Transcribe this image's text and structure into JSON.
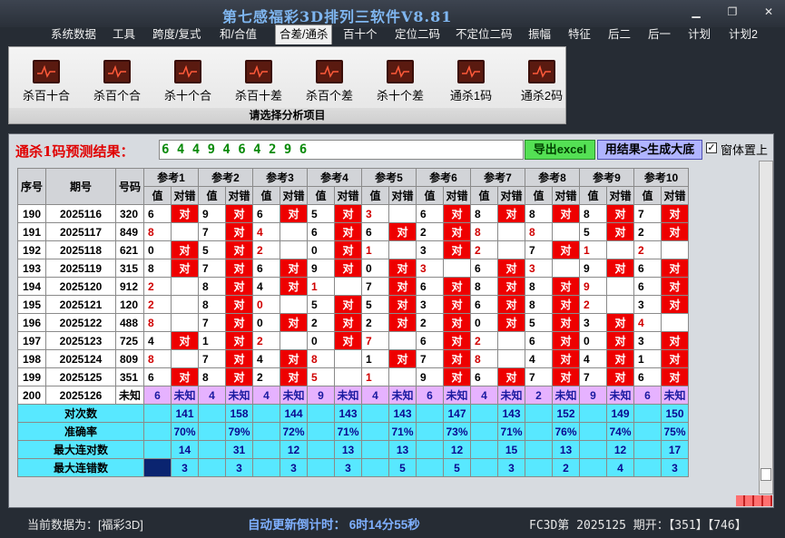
{
  "window": {
    "title": "第七感福彩3D排列三软件V8.81"
  },
  "menu": [
    "系统数据",
    "工具",
    "跨度/复式",
    "和/合值",
    "合差/通杀",
    "百十个",
    "定位二码",
    "不定位二码",
    "振幅",
    "特征",
    "后二",
    "后一",
    "计划",
    "计划2"
  ],
  "menu_active": "合差/通杀",
  "ribbon": {
    "buttons": [
      "杀百十合",
      "杀百个合",
      "杀十个合",
      "杀百十差",
      "杀百个差",
      "杀十个差",
      "通杀1码",
      "通杀2码"
    ],
    "caption": "请选择分析项目"
  },
  "result": {
    "label": "通杀1码预测结果：",
    "value": "6 4 4 9 4 6 4 2 9 6",
    "export_btn": "导出excel",
    "gen_btn": "用结果>生成大底",
    "checkbox_label": "窗体置上",
    "checkbox_checked": true
  },
  "table": {
    "col_headers": {
      "seq": "序号",
      "period": "期号",
      "number": "号码",
      "val": "值",
      "check": "对错"
    },
    "refs": [
      "参考1",
      "参考2",
      "参考3",
      "参考4",
      "参考5",
      "参考6",
      "参考7",
      "参考8",
      "参考9",
      "参考10"
    ],
    "rows": [
      {
        "seq": "190",
        "period": "2025116",
        "number": "320",
        "v": [
          "6",
          "9",
          "6",
          "5",
          "3",
          "6",
          "8",
          "8",
          "8",
          "7"
        ],
        "hit": [
          1,
          1,
          1,
          1,
          0,
          1,
          1,
          1,
          1,
          1
        ]
      },
      {
        "seq": "191",
        "period": "2025117",
        "number": "849",
        "v": [
          "8",
          "7",
          "4",
          "6",
          "6",
          "2",
          "8",
          "8",
          "5",
          "2"
        ],
        "hit": [
          0,
          1,
          0,
          1,
          1,
          1,
          0,
          0,
          1,
          1
        ]
      },
      {
        "seq": "192",
        "period": "2025118",
        "number": "621",
        "v": [
          "0",
          "5",
          "2",
          "0",
          "1",
          "3",
          "2",
          "7",
          "1",
          "2"
        ],
        "hit": [
          1,
          1,
          0,
          1,
          0,
          1,
          0,
          1,
          0,
          0
        ]
      },
      {
        "seq": "193",
        "period": "2025119",
        "number": "315",
        "v": [
          "8",
          "7",
          "6",
          "9",
          "0",
          "3",
          "6",
          "3",
          "9",
          "6"
        ],
        "hit": [
          1,
          1,
          1,
          1,
          1,
          0,
          1,
          0,
          1,
          1
        ]
      },
      {
        "seq": "194",
        "period": "2025120",
        "number": "912",
        "v": [
          "2",
          "8",
          "4",
          "1",
          "7",
          "6",
          "8",
          "8",
          "9",
          "6"
        ],
        "hit": [
          0,
          1,
          1,
          0,
          1,
          1,
          1,
          1,
          0,
          1
        ]
      },
      {
        "seq": "195",
        "period": "2025121",
        "number": "120",
        "v": [
          "2",
          "8",
          "0",
          "5",
          "5",
          "3",
          "6",
          "8",
          "2",
          "3"
        ],
        "hit": [
          0,
          1,
          0,
          1,
          1,
          1,
          1,
          1,
          0,
          1
        ]
      },
      {
        "seq": "196",
        "period": "2025122",
        "number": "488",
        "v": [
          "8",
          "7",
          "0",
          "2",
          "2",
          "2",
          "0",
          "5",
          "3",
          "4"
        ],
        "hit": [
          0,
          1,
          1,
          1,
          1,
          1,
          1,
          1,
          1,
          0
        ]
      },
      {
        "seq": "197",
        "period": "2025123",
        "number": "725",
        "v": [
          "4",
          "1",
          "2",
          "0",
          "7",
          "6",
          "2",
          "6",
          "0",
          "3"
        ],
        "hit": [
          1,
          1,
          0,
          1,
          0,
          1,
          0,
          1,
          1,
          1
        ]
      },
      {
        "seq": "198",
        "period": "2025124",
        "number": "809",
        "v": [
          "8",
          "7",
          "4",
          "8",
          "1",
          "7",
          "8",
          "4",
          "4",
          "1"
        ],
        "hit": [
          0,
          1,
          1,
          0,
          1,
          1,
          0,
          1,
          1,
          1
        ]
      },
      {
        "seq": "199",
        "period": "2025125",
        "number": "351",
        "v": [
          "6",
          "8",
          "2",
          "5",
          "1",
          "9",
          "6",
          "7",
          "7",
          "6"
        ],
        "hit": [
          1,
          1,
          1,
          0,
          0,
          1,
          1,
          1,
          1,
          1
        ]
      }
    ],
    "pending_row": {
      "seq": "200",
      "period": "2025126",
      "number": "未知",
      "v": [
        "6",
        "4",
        "4",
        "9",
        "4",
        "6",
        "4",
        "2",
        "9",
        "6"
      ],
      "status": "未知"
    },
    "stats": [
      {
        "label": "对次数",
        "values": [
          "141",
          "158",
          "144",
          "143",
          "143",
          "147",
          "143",
          "152",
          "149",
          "150"
        ]
      },
      {
        "label": "准确率",
        "values": [
          "70%",
          "79%",
          "72%",
          "71%",
          "71%",
          "73%",
          "71%",
          "76%",
          "74%",
          "75%"
        ]
      },
      {
        "label": "最大连对数",
        "values": [
          "14",
          "31",
          "12",
          "13",
          "13",
          "12",
          "15",
          "13",
          "12",
          "17"
        ]
      },
      {
        "label": "最大连错数",
        "values": [
          "3",
          "3",
          "3",
          "3",
          "5",
          "5",
          "3",
          "2",
          "4",
          "3"
        ]
      }
    ]
  },
  "status": {
    "current_data": "当前数据为：[福彩3D]",
    "countdown": "自动更新倒计时： 6时14分55秒",
    "period_info": "FC3D第 2025125 期开：【351】【746】"
  }
}
